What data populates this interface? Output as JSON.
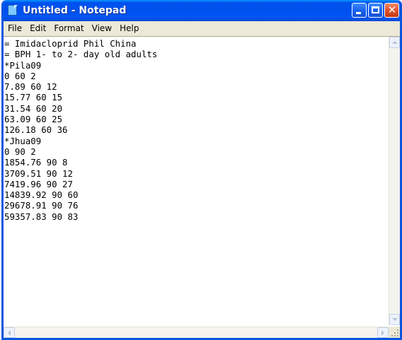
{
  "window": {
    "title": "Untitled - Notepad",
    "app_icon": "notepad-icon",
    "controls": [
      "minimize-icon",
      "maximize-icon",
      "close-icon"
    ]
  },
  "menubar": {
    "items": [
      "File",
      "Edit",
      "Format",
      "View",
      "Help"
    ]
  },
  "editor": {
    "lines": [
      "= Imidacloprid Phil China",
      "= BPH 1- to 2- day old adults",
      "*Pila09",
      "0 60 2",
      "7.89 60 12",
      "15.77 60 15",
      "31.54 60 20",
      "63.09 60 25",
      "126.18 60 36",
      "*Jhua09",
      "0 90 2",
      "1854.76 90 8",
      "3709.51 90 12",
      "7419.96 90 27",
      "14839.92 90 60",
      "29678.91 90 76",
      "59357.83 90 83"
    ]
  },
  "colors": {
    "titlebar": "#0050ee",
    "frame": "#0a55e0",
    "close_button": "#e2522b",
    "menubar_bg": "#ece9d8",
    "text": "#000000"
  }
}
